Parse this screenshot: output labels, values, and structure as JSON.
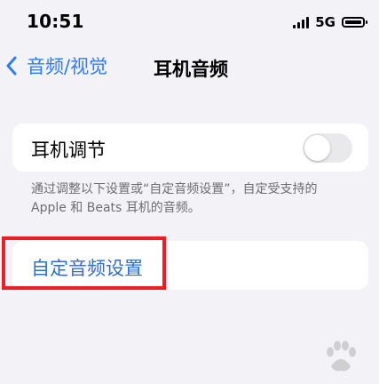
{
  "status_bar": {
    "time": "10:51",
    "network": "5G",
    "signal_bars": 4,
    "battery_icon": "battery-icon"
  },
  "nav": {
    "back_label": "音频/视觉",
    "back_icon": "chevron-left-icon",
    "title": "耳机音频"
  },
  "headphone_setting": {
    "label": "耳机调节",
    "toggle_on": false
  },
  "footer": {
    "text": "通过调整以下设置或“自定音频设置”，自定受支持的 Apple 和 Beats 耳机的音频。"
  },
  "custom_audio": {
    "label": "自定音频设置"
  },
  "colors": {
    "accent": "#2f7cf6",
    "highlight": "#ef1c23",
    "background": "#f2f2f7"
  }
}
